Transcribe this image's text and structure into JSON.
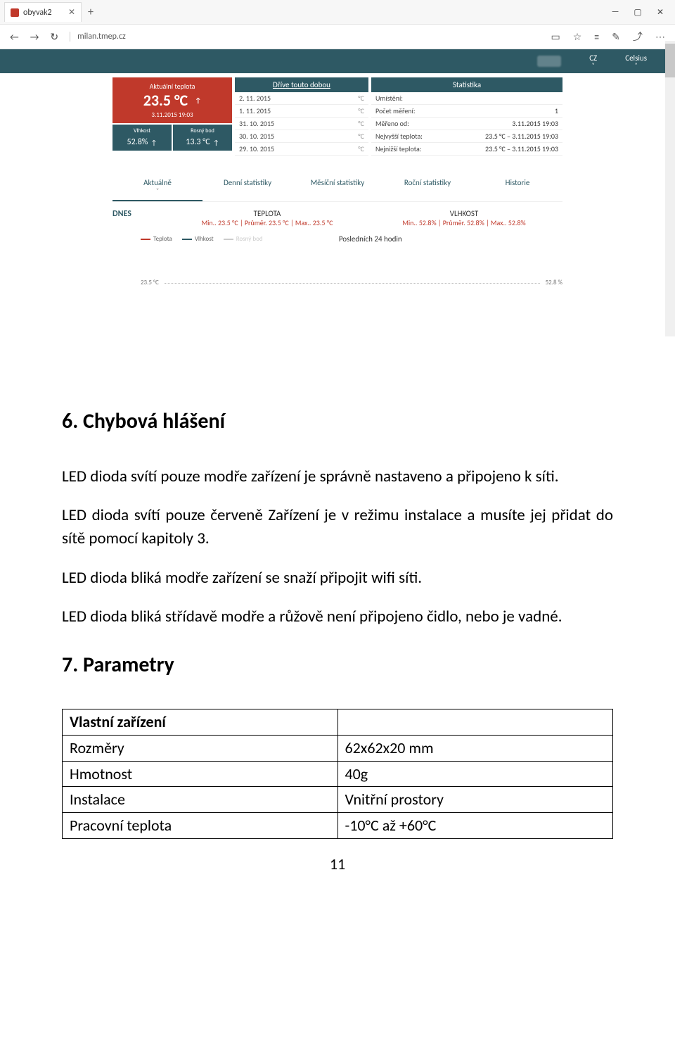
{
  "browser": {
    "tab_title": "obyvak2",
    "url": "milan.tmep.cz",
    "win_minimize": "—",
    "win_maximize": "▢",
    "win_close": "✕",
    "newtab": "+",
    "back": "←",
    "fwd": "→",
    "reload": "↻",
    "reader": "▭",
    "star": "☆",
    "hub": "≡",
    "note": "✎",
    "share": "⤴",
    "more": "⋯"
  },
  "appbar": {
    "lang": "CZ",
    "unit": "Celsius",
    "chev": "˅"
  },
  "current": {
    "label": "Aktuální teplota",
    "value": "23.5 °C",
    "arrow": "↑",
    "timestamp": "3.11.2015 19:03",
    "hum_label": "Vlhkost",
    "hum_value": "52.8%",
    "dew_label": "Rosný bod",
    "dew_value": "13.3 °C"
  },
  "history": {
    "title": "Dříve touto dobou",
    "unit": "°C",
    "rows": [
      {
        "d": "2. 11. 2015"
      },
      {
        "d": "1. 11. 2015"
      },
      {
        "d": "31. 10. 2015"
      },
      {
        "d": "30. 10. 2015"
      },
      {
        "d": "29. 10. 2015"
      }
    ]
  },
  "stats": {
    "title": "Statistika",
    "rows": [
      {
        "k": "Umístění:",
        "v": ""
      },
      {
        "k": "Počet měření:",
        "v": "1"
      },
      {
        "k": "Měřeno od:",
        "v": "3.11.2015 19:03"
      },
      {
        "k": "Nejvyšší teplota:",
        "v": "23.5 °C – 3.11.2015 19:03"
      },
      {
        "k": "Nejnižší teplota:",
        "v": "23.5 °C – 3.11.2015 19:03"
      }
    ]
  },
  "tabs": {
    "items": [
      "Aktuálně",
      "Denní statistiky",
      "Měsíční statistiky",
      "Roční statistiky",
      "Historie"
    ],
    "chev": "˅"
  },
  "summary": {
    "today": "DNES",
    "temp_title": "TEPLOTA",
    "temp_line_a": "Min.. ",
    "temp_min": "23.5 °C",
    "temp_line_b": " | Průměr. ",
    "temp_avg": "23.5 °C",
    "temp_line_c": " | Max.. ",
    "temp_max": "23.5 °C",
    "hum_title": "VLHKOST",
    "hum_min": "52.8%",
    "hum_avg": "52.8%",
    "hum_max": "52.8%"
  },
  "legend": {
    "items": [
      "Teplota",
      "Vlhkost",
      "Rosný bod"
    ],
    "chart_title": "Posledních 24 hodin",
    "axis_left": "23.5 °C",
    "axis_right": "52.8 %"
  },
  "doc": {
    "h6": "6.   Chybová hlášení",
    "p1": "LED dioda svítí pouze modře zařízení je správně nastaveno a připojeno k síti.",
    "p2": "LED dioda svítí pouze červeně Zařízení je v režimu instalace a musíte jej přidat do sítě pomocí kapitoly 3.",
    "p3": "LED dioda bliká modře zařízení se snaží připojit wifi síti.",
    "p4": "LED dioda bliká střídavě modře a růžově není připojeno čidlo, nebo je vadné.",
    "h7": "7.   Parametry",
    "table": [
      [
        "Vlastní zařízení",
        ""
      ],
      [
        "Rozměry",
        "62x62x20 mm"
      ],
      [
        "Hmotnost",
        "40g"
      ],
      [
        "Instalace",
        "Vnitřní prostory"
      ],
      [
        "Pracovní teplota",
        "-10°C až +60°C"
      ]
    ],
    "page": "11"
  }
}
